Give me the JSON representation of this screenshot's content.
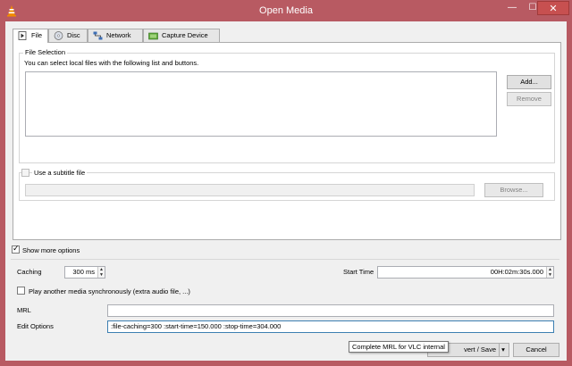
{
  "window": {
    "title": "Open Media",
    "minimize_glyph": "—",
    "maximize_glyph": "☐",
    "close_glyph": "✕"
  },
  "tabs": [
    {
      "label": "File",
      "icon": "file-icon",
      "active": true
    },
    {
      "label": "Disc",
      "icon": "disc-icon",
      "active": false
    },
    {
      "label": "Network",
      "icon": "network-icon",
      "active": false
    },
    {
      "label": "Capture Device",
      "icon": "capture-device-icon",
      "active": false
    }
  ],
  "file_selection": {
    "group_title": "File Selection",
    "description": "You can select local files with the following list and buttons.",
    "add_label": "Add...",
    "remove_label": "Remove"
  },
  "subtitle": {
    "checkbox_label": "Use a subtitle file",
    "browse_label": "Browse..."
  },
  "options": {
    "show_more_label": "Show more options",
    "caching_label": "Caching",
    "caching_value": "300 ms",
    "start_time_label": "Start Time",
    "start_time_value": "00H:02m:30s.000",
    "play_another_label": "Play another media synchronously (extra audio file, ...)",
    "mrl_label": "MRL",
    "mrl_value": "",
    "edit_options_label": "Edit Options",
    "edit_options_value": ":file-caching=300 :start-time=150.000 :stop-time=304.000"
  },
  "footer": {
    "convert_label": "vert / Save",
    "dropdown_glyph": "▾",
    "cancel_label": "Cancel",
    "tooltip": "Complete MRL for VLC internal"
  },
  "colors": {
    "titlebar": "#b85a62",
    "close_button": "#c75050",
    "client_bg": "#f0f0f0"
  }
}
